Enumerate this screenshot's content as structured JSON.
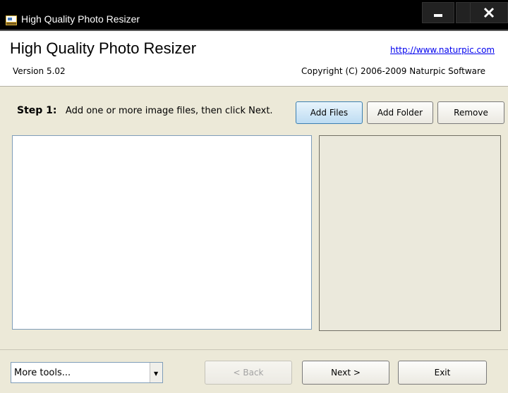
{
  "window": {
    "title": "High Quality Photo Resizer"
  },
  "header": {
    "app_title": "High Quality Photo Resizer",
    "version": "Version 5.02",
    "website": "http://www.naturpic.com",
    "copyright": "Copyright (C) 2006-2009 Naturpic Software"
  },
  "step": {
    "label": "Step 1:",
    "instruction": "Add one or more image files, then click Next."
  },
  "toolbar": {
    "add_files": "Add Files",
    "add_folder": "Add Folder",
    "remove": "Remove"
  },
  "footer": {
    "tools_select": "More tools...",
    "back": "< Back",
    "next": "Next >",
    "exit": "Exit"
  },
  "colors": {
    "window_bg": "#ece9d8",
    "preview_bg": "#ebe9dc",
    "link": "#0000ee",
    "primary_button": "#bddcf2"
  },
  "icons": {
    "app": "photo-resizer-app-icon",
    "minimize": "minimize-icon",
    "close": "close-icon",
    "dropdown": "chevron-down-icon"
  }
}
